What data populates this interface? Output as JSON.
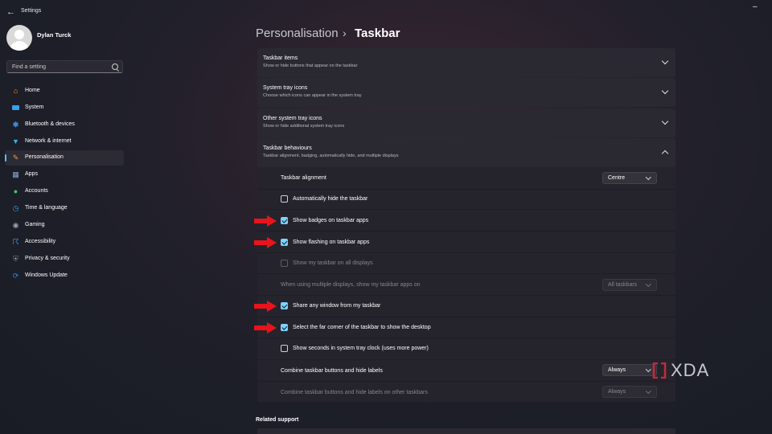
{
  "window": {
    "title": "Settings"
  },
  "profile": {
    "name": "Dylan Turck"
  },
  "search": {
    "placeholder": "Find a setting"
  },
  "sidebar": {
    "items": [
      {
        "label": "Home",
        "icon": "home-icon",
        "color": "#f2a541"
      },
      {
        "label": "System",
        "icon": "monitor-icon",
        "color": "#3aa0e8"
      },
      {
        "label": "Bluetooth & devices",
        "icon": "bluetooth-icon",
        "color": "#3a8ee8"
      },
      {
        "label": "Network & internet",
        "icon": "wifi-icon",
        "color": "#3ab0e8"
      },
      {
        "label": "Personalisation",
        "icon": "brush-icon",
        "color": "#e89a5a",
        "active": true
      },
      {
        "label": "Apps",
        "icon": "apps-icon",
        "color": "#8aa6d8"
      },
      {
        "label": "Accounts",
        "icon": "person-icon",
        "color": "#3fc48c"
      },
      {
        "label": "Time & language",
        "icon": "globe-clock-icon",
        "color": "#3aa0e8"
      },
      {
        "label": "Gaming",
        "icon": "gamepad-icon",
        "color": "#a0a0b0"
      },
      {
        "label": "Accessibility",
        "icon": "accessibility-icon",
        "color": "#3a9ee8"
      },
      {
        "label": "Privacy & security",
        "icon": "shield-icon",
        "color": "#8a8a9a"
      },
      {
        "label": "Windows Update",
        "icon": "update-icon",
        "color": "#2a8ee0"
      }
    ]
  },
  "header": {
    "parent": "Personalisation",
    "separator": "›",
    "current": "Taskbar"
  },
  "cards": [
    {
      "title": "Taskbar items",
      "desc": "Show or hide buttons that appear on the taskbar",
      "expanded": false
    },
    {
      "title": "System tray icons",
      "desc": "Choose which icons can appear in the system tray",
      "expanded": false
    },
    {
      "title": "Other system tray icons",
      "desc": "Show or hide additional system tray icons",
      "expanded": false
    },
    {
      "title": "Taskbar behaviours",
      "desc": "Taskbar alignment, badging, automatically hide, and multiple displays",
      "expanded": true
    }
  ],
  "behaviours": {
    "alignment": {
      "label": "Taskbar alignment",
      "value": "Centre"
    },
    "autohide": {
      "label": "Automatically hide the taskbar",
      "checked": false
    },
    "badges": {
      "label": "Show badges on taskbar apps",
      "checked": true
    },
    "flashing": {
      "label": "Show flashing on taskbar apps",
      "checked": true
    },
    "all_displays": {
      "label": "Show my taskbar on all displays",
      "checked": false,
      "disabled": true
    },
    "multi_display": {
      "label": "When using multiple displays, show my taskbar apps on",
      "value": "All taskbars",
      "disabled": true
    },
    "share_window": {
      "label": "Share any window from my taskbar",
      "checked": true
    },
    "far_corner": {
      "label": "Select the far corner of the taskbar to show the desktop",
      "checked": true
    },
    "seconds": {
      "label": "Show seconds in system tray clock (uses more power)",
      "checked": false
    },
    "combine": {
      "label": "Combine taskbar buttons and hide labels",
      "value": "Always"
    },
    "combine_other": {
      "label": "Combine taskbar buttons and hide labels on other taskbars",
      "value": "Always",
      "disabled": true
    }
  },
  "related": {
    "title": "Related support"
  },
  "watermark": {
    "text": "XDA"
  },
  "colors": {
    "accent": "#7cd4ff",
    "annotation_arrow": "#e8141a"
  }
}
